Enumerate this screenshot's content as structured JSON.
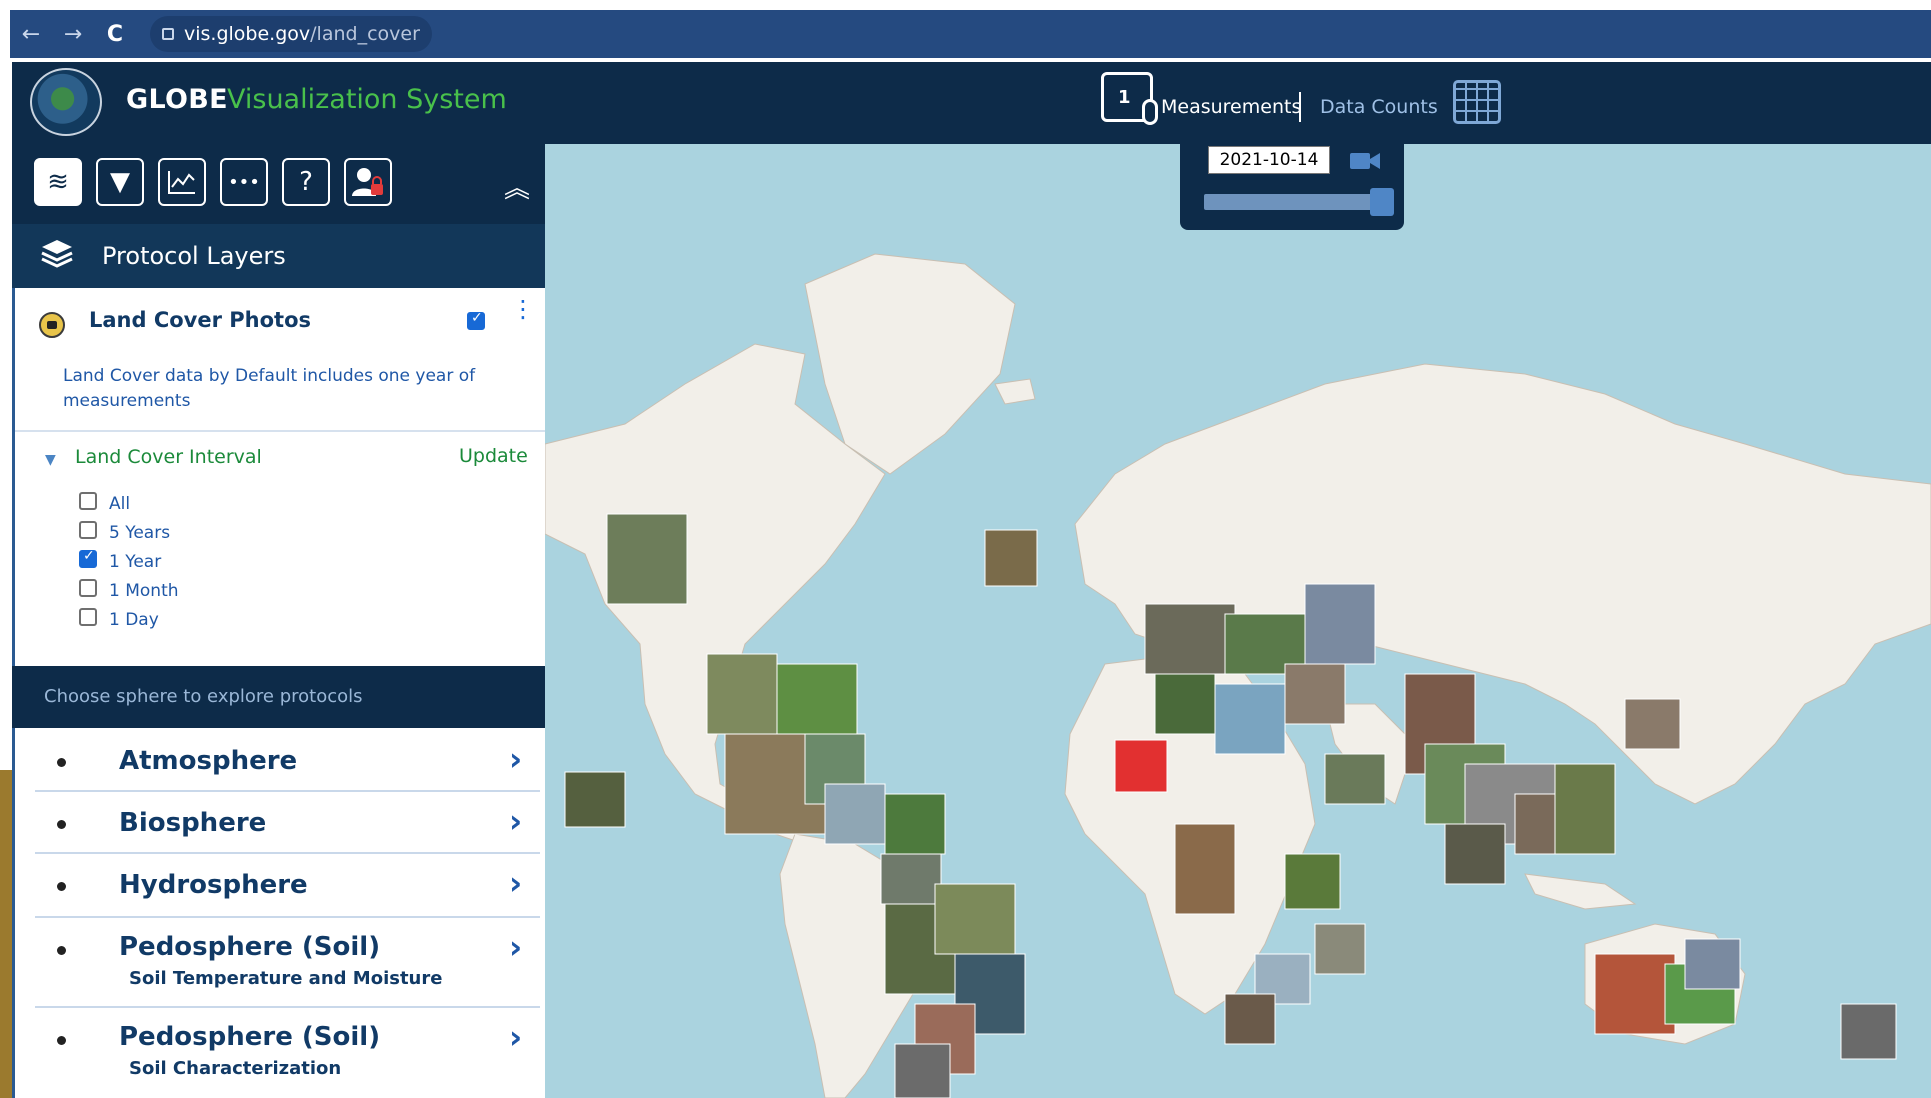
{
  "browser": {
    "url_host": "vis.globe.gov",
    "url_path": "/land_cover",
    "back_icon": "←",
    "forward_icon": "→",
    "reload_icon": "C"
  },
  "header": {
    "title": "GLOBE",
    "subtitle": "Visualization System",
    "measurements_label": "Measurements",
    "data_counts_label": "Data Counts",
    "measurements_icon_digit": "1"
  },
  "toolbar": {
    "buttons": [
      {
        "icon": "layers-icon",
        "glyph": "≋"
      },
      {
        "icon": "filter-icon",
        "glyph": "▼"
      },
      {
        "icon": "chart-icon",
        "glyph": "⌇"
      },
      {
        "icon": "more-icon",
        "glyph": "•••"
      },
      {
        "icon": "help-icon",
        "glyph": "?"
      },
      {
        "icon": "user-lock-icon",
        "glyph": "●"
      }
    ],
    "collapse_glyph": "︽"
  },
  "layers_panel": {
    "title": "Protocol Layers",
    "layer": {
      "name": "Land Cover Photos",
      "checked": true,
      "description": "Land Cover data by Default includes one year of measurements"
    },
    "interval": {
      "title": "Land Cover Interval",
      "update_label": "Update",
      "options": [
        {
          "label": "All",
          "checked": false
        },
        {
          "label": "5 Years",
          "checked": false
        },
        {
          "label": "1 Year",
          "checked": true
        },
        {
          "label": "1 Month",
          "checked": false
        },
        {
          "label": "1 Day",
          "checked": false
        }
      ]
    }
  },
  "spheres": {
    "header": "Choose sphere to explore protocols",
    "items": [
      {
        "name": "Atmosphere",
        "sub": ""
      },
      {
        "name": "Biosphere",
        "sub": ""
      },
      {
        "name": "Hydrosphere",
        "sub": ""
      },
      {
        "name": "Pedosphere (Soil)",
        "sub": "Soil Temperature and Moisture"
      },
      {
        "name": "Pedosphere (Soil)",
        "sub": "Soil Characterization"
      }
    ]
  },
  "timeline": {
    "date": "2021-10-14",
    "position": 1.0
  },
  "colors": {
    "header_bg": "#0d2b49",
    "accent_green": "#49c14b",
    "ocean": "#aad3df",
    "land": "#f2efe9"
  }
}
